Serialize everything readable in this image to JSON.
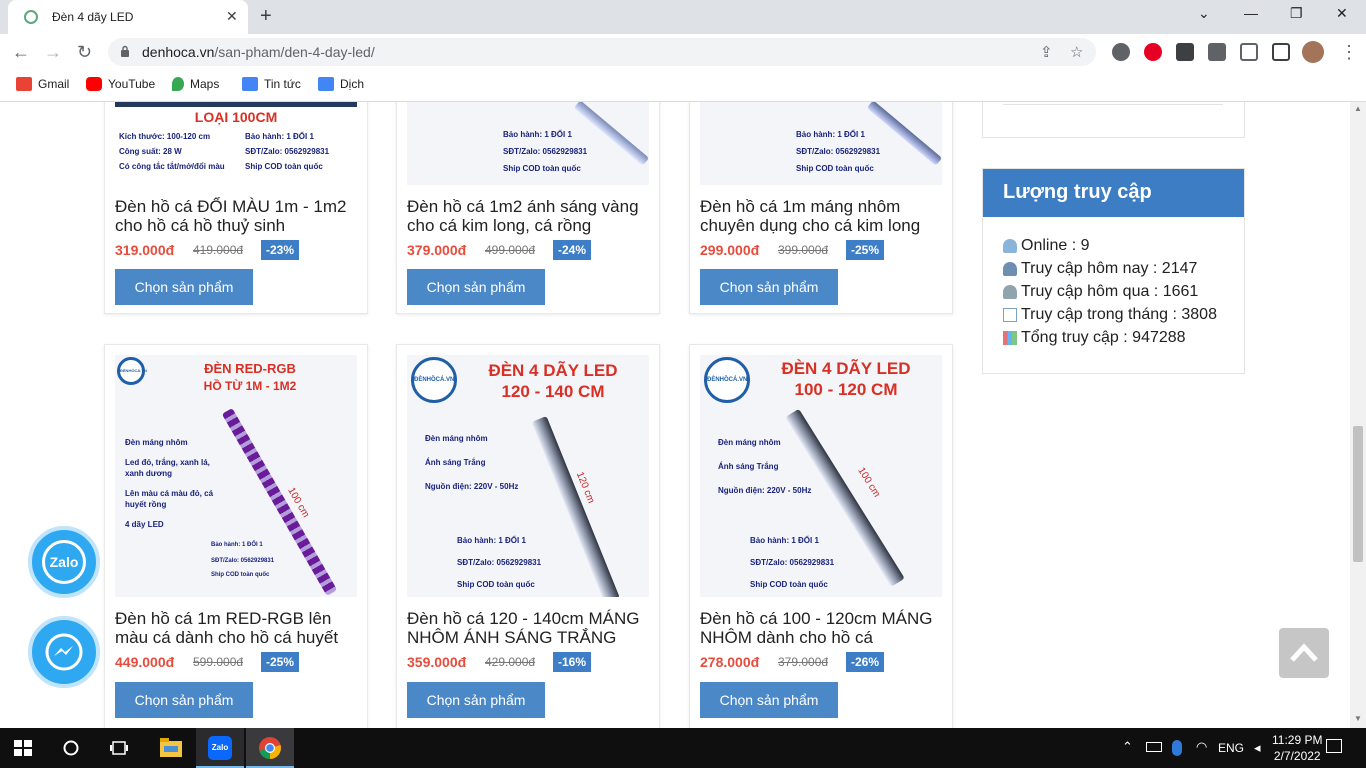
{
  "browser": {
    "tab_title": "Đèn 4 dãy LED",
    "url_host": "denhoca.vn",
    "url_path": "/san-pham/den-4-day-led/",
    "bookmarks": [
      "Gmail",
      "YouTube",
      "Maps",
      "Tin tức",
      "Dịch"
    ]
  },
  "products": [
    {
      "name": "Đèn hồ cá ĐỔI MÀU 1m - 1m2 cho hồ cá hồ thuỷ sinh",
      "price": "319.000đ",
      "old_price": "419.000đ",
      "discount": "-23%",
      "button": "Chọn sản phẩm",
      "image": {
        "heading": "LOẠI 100CM",
        "notes": [
          "Kích thước: 100-120 cm",
          "Công suất: 28 W",
          "Có công tắc tắt/mở/đổi màu"
        ],
        "notes2": [
          "Bảo hành: 1 ĐỔI 1",
          "SĐT/Zalo: 0562929831",
          "Ship COD toàn quốc"
        ]
      }
    },
    {
      "name": "Đèn hồ cá 1m2 ánh sáng vàng cho cá kim long, cá rồng",
      "price": "379.000đ",
      "old_price": "499.000đ",
      "discount": "-24%",
      "button": "Chọn sản phẩm",
      "image": {
        "notes2": [
          "Bảo hành: 1 ĐỔI 1",
          "SĐT/Zalo: 0562929831",
          "Ship COD toàn quốc"
        ]
      }
    },
    {
      "name": "Đèn hồ cá 1m máng nhôm chuyên dụng cho cá kim long",
      "price": "299.000đ",
      "old_price": "399.000đ",
      "discount": "-25%",
      "button": "Chọn sản phẩm",
      "image": {
        "notes2": [
          "Bảo hành: 1 ĐỔI 1",
          "SĐT/Zalo: 0562929831",
          "Ship COD toàn quốc"
        ]
      }
    },
    {
      "name": "Đèn hồ cá 1m RED-RGB lên màu cá dành cho hồ cá huyết rồng",
      "price": "449.000đ",
      "old_price": "599.000đ",
      "discount": "-25%",
      "button": "Chọn sản phẩm",
      "image": {
        "heading": "ĐÈN RED-RGB",
        "heading2": "HỒ TỪ 1M - 1M2",
        "measure": "100 cm",
        "notes": [
          "Đèn máng nhôm",
          "Led đỏ, trắng, xanh lá, xanh dương",
          "Lên màu cá màu đỏ, cá huyết rồng",
          "4 dãy LED"
        ],
        "notes2": [
          "Bảo hành: 1 ĐỔI 1",
          "SĐT/Zalo: 0562929831",
          "Ship COD toàn quốc"
        ]
      }
    },
    {
      "name": "Đèn hồ cá 120 - 140cm MÁNG NHÔM ÁNH SÁNG TRẮNG",
      "price": "359.000đ",
      "old_price": "429.000đ",
      "discount": "-16%",
      "button": "Chọn sản phẩm",
      "image": {
        "heading": "ĐÈN 4 DÃY LED",
        "heading2": "120 - 140 CM",
        "measure": "120 cm",
        "notes": [
          "Đèn máng nhôm",
          "Ánh sáng Trắng",
          "Nguồn điện: 220V - 50Hz"
        ],
        "notes2": [
          "Bảo hành: 1 ĐỔI 1",
          "SĐT/Zalo: 0562929831",
          "Ship COD toàn quốc"
        ]
      }
    },
    {
      "name": "Đèn hồ cá 100 - 120cm MÁNG NHÔM dành cho hồ cá",
      "price": "278.000đ",
      "old_price": "379.000đ",
      "discount": "-26%",
      "button": "Chọn sản phẩm",
      "image": {
        "heading": "ĐÈN 4 DÃY LED",
        "heading2": "100 - 120 CM",
        "measure": "100 cm",
        "notes": [
          "Đèn máng nhôm",
          "Ánh sáng Trắng",
          "Nguồn điện: 220V - 50Hz"
        ],
        "notes2": [
          "Bảo hành: 1 ĐỔI 1",
          "SĐT/Zalo: 0562929831",
          "Ship COD toàn quốc"
        ]
      }
    }
  ],
  "logo_text": "ĐÈNHỒCÁ.VN",
  "visits": {
    "title": "Lượng truy cập",
    "rows": [
      "Online : 9",
      "Truy cập hôm nay : 2147",
      "Truy cập hôm qua : 1661",
      "Truy cập trong tháng : 3808",
      "Tổng truy cập : 947288"
    ]
  },
  "floating": {
    "zalo": "Zalo"
  },
  "taskbar": {
    "time": "11:29 PM",
    "date": "2/7/2022",
    "lang": "ENG"
  },
  "colors": {
    "price": "#e74c3c",
    "accent": "#3c7dc4",
    "button": "#4a88c7"
  }
}
